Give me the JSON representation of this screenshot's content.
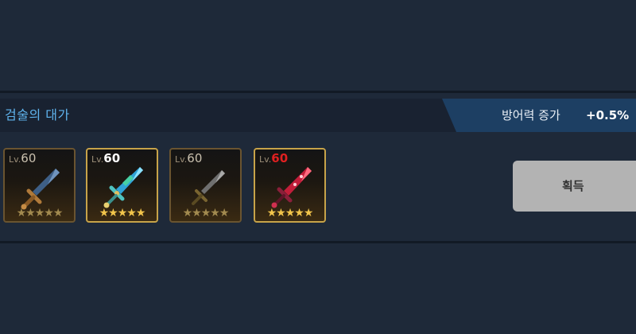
{
  "panel": {
    "title": "검술의 대가",
    "stat_label": "방어력 증가",
    "stat_value": "+0.5%",
    "title_color": "#5fb4ee"
  },
  "items": [
    {
      "lv_prefix": "Lv.",
      "level": "60",
      "level_color": "#c9c0ae",
      "stars": "★★★★★",
      "icon": "bronze-sword-icon",
      "highlight": false
    },
    {
      "lv_prefix": "Lv.",
      "level": "60",
      "level_color": "#ffffff",
      "stars": "★★★★★",
      "icon": "crystal-sword-icon",
      "highlight": true
    },
    {
      "lv_prefix": "Lv.",
      "level": "60",
      "level_color": "#c9c0ae",
      "stars": "★★★★★",
      "icon": "steel-sword-icon",
      "highlight": false
    },
    {
      "lv_prefix": "Lv.",
      "level": "60",
      "level_color": "#e02020",
      "stars": "★★★★★",
      "icon": "crimson-sword-icon",
      "highlight": true
    }
  ],
  "acquire_button": {
    "label": "획득"
  }
}
